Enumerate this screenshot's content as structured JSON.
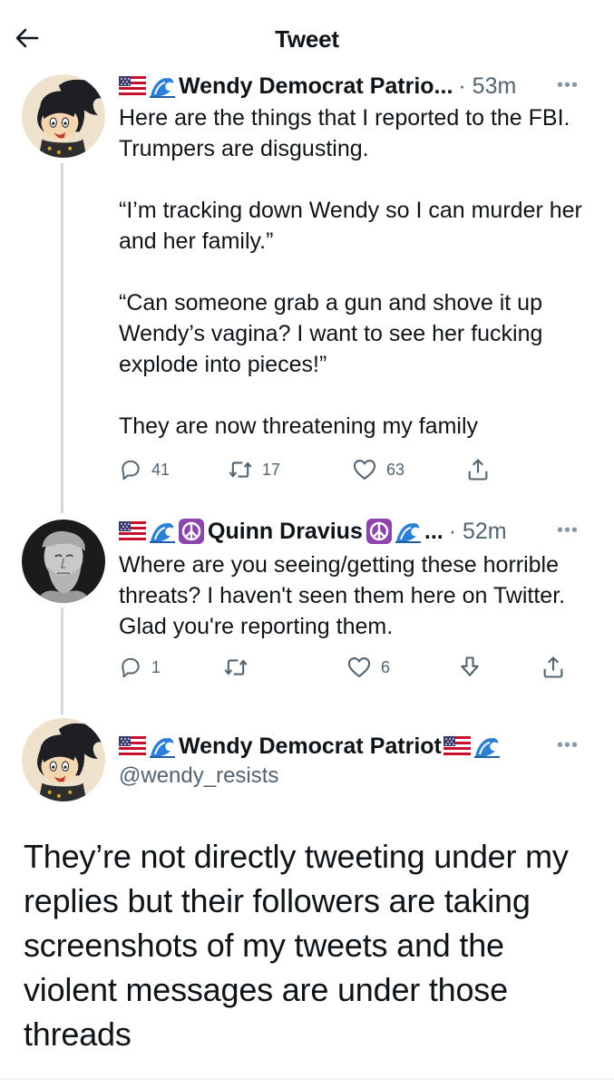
{
  "header": {
    "title": "Tweet"
  },
  "tweets": [
    {
      "name": "Wendy Democrat Patrio...",
      "time": "· 53m",
      "more": "•••",
      "text": "Here are the things that I reported to the FBI. Trumpers are disgusting.\n\n“I’m tracking down Wendy so I can murder her and her family.”\n\n“Can someone grab a gun and shove it up Wendy’s vagina? I want to see her fucking explode into pieces!”\n\nThey are now threatening my family",
      "replies": "41",
      "retweets": "17",
      "likes": "63"
    },
    {
      "name": "Quinn Dravius",
      "suffix": "...",
      "time": "· 52m",
      "more": "•••",
      "text": "Where are you seeing/getting these horrible threats? I haven't seen them here on Twitter. Glad you're reporting them.",
      "replies": "1",
      "likes": "6"
    }
  ],
  "main_tweet": {
    "name": "Wendy Democrat Patriot",
    "handle": "@wendy_resists",
    "more": "•••",
    "text": "They’re not directly tweeting under my replies but their followers are taking screenshots of my tweets and the violent messages are under those threads"
  },
  "icons": {
    "back": "arrow-left-icon",
    "reply": "reply-icon",
    "retweet": "retweet-icon",
    "like": "heart-icon",
    "share": "share-icon",
    "downvote": "downvote-icon",
    "flag": "us-flag-emoji",
    "wave": "wave-emoji",
    "peace": "peace-symbol-emoji"
  },
  "colors": {
    "text": "#0f1419",
    "secondary": "#536471",
    "thread_line": "#cfd9de",
    "peace_purple": "#8e44ad",
    "wave_blue": "#2b7fd4"
  }
}
